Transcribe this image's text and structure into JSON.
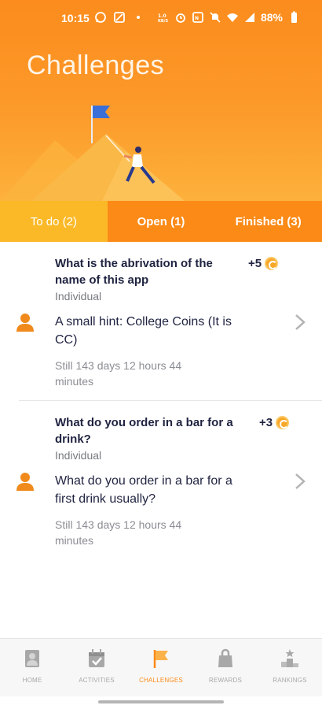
{
  "status_bar": {
    "time": "10:15",
    "battery": "88%"
  },
  "header": {
    "title": "Challenges"
  },
  "tabs": [
    {
      "label": "To do (2)",
      "active": true
    },
    {
      "label": "Open (1)",
      "active": false
    },
    {
      "label": "Finished (3)",
      "active": false
    }
  ],
  "challenges": [
    {
      "title": "What is the abrivation of the name of this app",
      "points": "+5",
      "type": "Individual",
      "description": "A small hint: College Coins (It is CC)",
      "time_left": "Still 143 days 12 hours 44 minutes"
    },
    {
      "title": "What do you order in a bar for a drink?",
      "points": "+3",
      "type": "Individual",
      "description": "What do you order in a bar for a first drink usually?",
      "time_left": "Still 143 days 12 hours 44 minutes"
    }
  ],
  "bottom_nav": [
    {
      "label": "HOME",
      "icon": "person-icon"
    },
    {
      "label": "ACTIVITIES",
      "icon": "calendar-icon"
    },
    {
      "label": "CHALLENGES",
      "icon": "flag-icon",
      "active": true
    },
    {
      "label": "REWARDS",
      "icon": "bag-icon"
    },
    {
      "label": "RANKINGS",
      "icon": "podium-icon"
    }
  ],
  "colors": {
    "brand_orange": "#fb8a17",
    "active_tab": "#fbb928",
    "text_dark": "#1f2340",
    "coin": "#f7a828"
  }
}
